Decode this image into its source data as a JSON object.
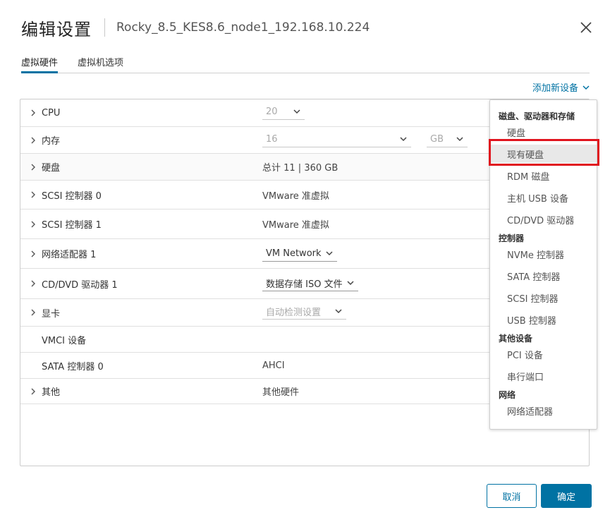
{
  "dialog": {
    "title": "编辑设置",
    "subtitle": "Rocky_8.5_KES8.6_node1_192.168.10.224"
  },
  "tabs": [
    {
      "label": "虚拟硬件",
      "active": true
    },
    {
      "label": "虚拟机选项",
      "active": false
    }
  ],
  "add_device_label": "添加新设备",
  "hardware": {
    "cpu": {
      "label": "CPU",
      "value": "20"
    },
    "memory": {
      "label": "内存",
      "value": "16",
      "unit": "GB"
    },
    "disk": {
      "label": "硬盘",
      "value": "总计 11 | 360 GB"
    },
    "scsi0": {
      "label": "SCSI 控制器 0",
      "value": "VMware 准虚拟"
    },
    "scsi1": {
      "label": "SCSI 控制器 1",
      "value": "VMware 准虚拟"
    },
    "network": {
      "label": "网络适配器 1",
      "value": "VM Network"
    },
    "cddvd": {
      "label": "CD/DVD 驱动器 1",
      "value": "数据存储 ISO 文件"
    },
    "video": {
      "label": "显卡",
      "value": "自动检测设置"
    },
    "vmci": {
      "label": "VMCI 设备"
    },
    "sata0": {
      "label": "SATA 控制器 0",
      "value": "AHCI"
    },
    "other": {
      "label": "其他",
      "value": "其他硬件"
    }
  },
  "menu": {
    "group_storage": "磁盘、驱动器和存储",
    "hard_disk": "硬盘",
    "existing_disk": "现有硬盘",
    "rdm_disk": "RDM 磁盘",
    "host_usb": "主机 USB 设备",
    "cd_dvd": "CD/DVD 驱动器",
    "group_controllers": "控制器",
    "nvme": "NVMe 控制器",
    "sata": "SATA 控制器",
    "scsi": "SCSI 控制器",
    "usb": "USB 控制器",
    "group_other": "其他设备",
    "pci": "PCI 设备",
    "serial": "串行端口",
    "group_network": "网络",
    "network_adapter": "网络适配器"
  },
  "footer": {
    "cancel": "取消",
    "ok": "确定"
  },
  "colors": {
    "accent": "#0072a3",
    "highlight": "#e0141e"
  }
}
